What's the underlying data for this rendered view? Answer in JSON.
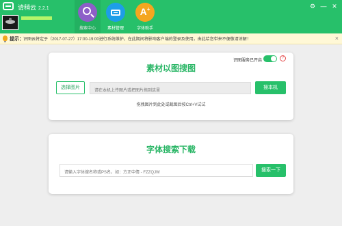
{
  "app": {
    "title": "请稍云",
    "version": "2.2.1"
  },
  "nav": [
    {
      "label": "搜索中心",
      "icon": "magnifier-icon"
    },
    {
      "label": "素材管理",
      "icon": "drive-icon"
    },
    {
      "label": "字体助手",
      "icon": "font-assistant-icon",
      "glyph": "A"
    }
  ],
  "window_controls": {
    "settings": "⚙",
    "minimize": "—",
    "close": "✕"
  },
  "notice": {
    "label": "提示：",
    "text": "识图云将定于（2017-07-27）17:00-19:00进行系统维护，在此期间将影响客户端的登录及使用，由此给您带来不便敬请谅解！",
    "close": "×"
  },
  "image_search": {
    "title": "素材以图搜图",
    "toggle_label": "识图服务已开启",
    "toggle_on": true,
    "help": "?",
    "select_button": "选择图片",
    "input_placeholder": "请在本机上传图片或把图片拖到这里",
    "search_button": "搜本机",
    "hint": "拖拽图片到此处或截图后按Ctrl+V试试"
  },
  "font_search": {
    "title": "字体搜索下载",
    "input_placeholder": "请输入字体搜名称或PS名，如：方正中倩 - FZZQJW",
    "search_button": "搜索一下"
  },
  "colors": {
    "accent": "#27c06a",
    "title_green": "#27b564",
    "nav_purple": "#8d5fc8",
    "nav_blue": "#1d9ee8",
    "nav_orange": "#f4a620"
  }
}
